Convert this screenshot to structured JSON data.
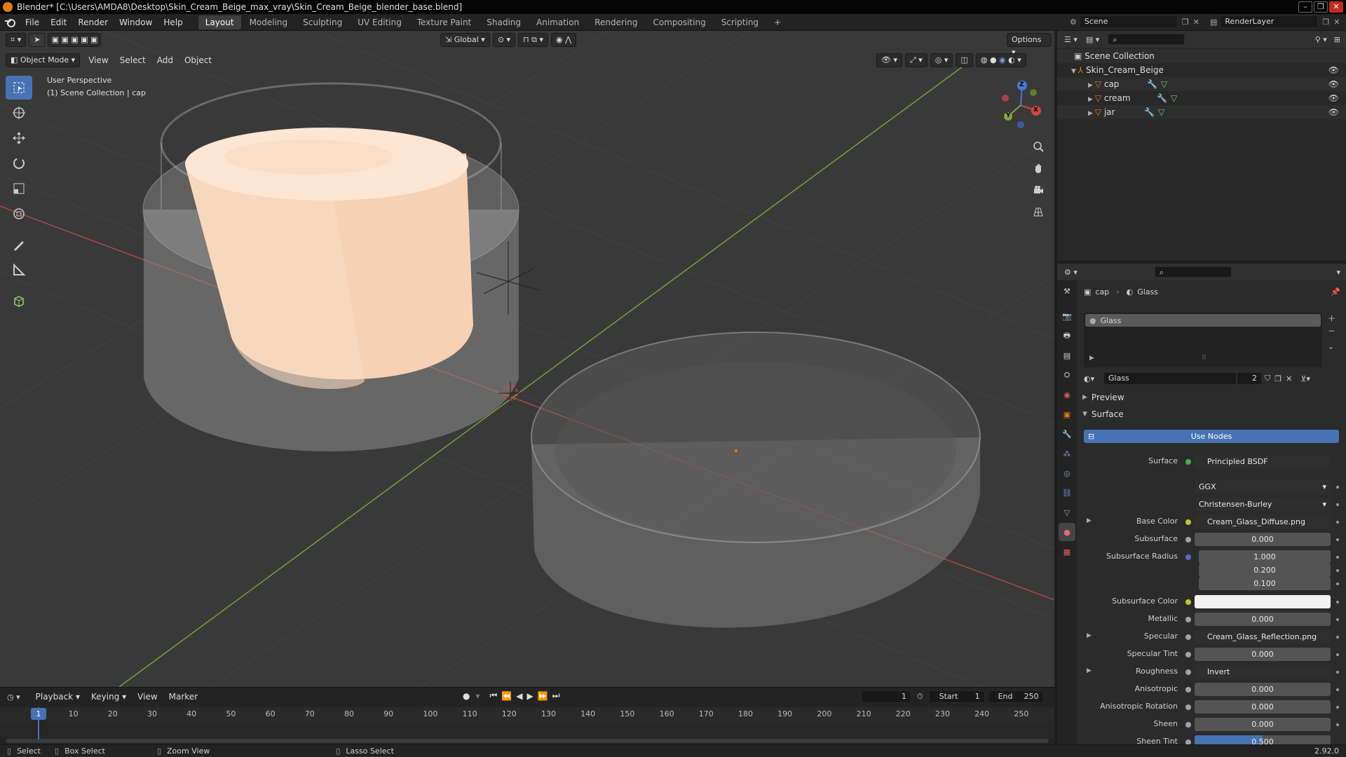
{
  "window": {
    "title": "Blender* [C:\\Users\\AMDA8\\Desktop\\Skin_Cream_Beige_max_vray\\Skin_Cream_Beige_blender_base.blend]"
  },
  "menu": {
    "items": [
      "File",
      "Edit",
      "Render",
      "Window",
      "Help"
    ],
    "workspaces": [
      "Layout",
      "Modeling",
      "Sculpting",
      "UV Editing",
      "Texture Paint",
      "Shading",
      "Animation",
      "Rendering",
      "Compositing",
      "Scripting"
    ],
    "active_workspace": "Layout",
    "add_tab": "+",
    "scene": "Scene",
    "render_layer": "RenderLayer"
  },
  "viewport": {
    "transform_orientation": "Global",
    "options_label": "Options",
    "mode": "Object Mode",
    "menus": [
      "View",
      "Select",
      "Add",
      "Object"
    ],
    "perspective_label": "User Perspective",
    "collection_label": "(1) Scene Collection | cap",
    "gizmo_axes": {
      "x": "X",
      "y": "Y",
      "z": "Z"
    }
  },
  "outliner": {
    "root": "Scene Collection",
    "collection": "Skin_Cream_Beige",
    "objects": [
      {
        "name": "cap"
      },
      {
        "name": "cream"
      },
      {
        "name": "jar"
      }
    ]
  },
  "properties": {
    "breadcrumb_object": "cap",
    "breadcrumb_material": "Glass",
    "material_slots": [
      "Glass"
    ],
    "material_name": "Glass",
    "user_count": "2",
    "panels": {
      "preview": "Preview",
      "surface": "Surface"
    },
    "use_nodes_label": "Use Nodes",
    "surface_label": "Surface",
    "surface_shader": "Principled BSDF",
    "distribution": "GGX",
    "subsurface_method": "Christensen-Burley",
    "rows": [
      {
        "label": "Base Color",
        "value": "Cream_Glass_Diffuse.png"
      },
      {
        "label": "Subsurface",
        "value": "0.000"
      },
      {
        "label": "Subsurface Radius",
        "value": "1.000"
      },
      {
        "label": "",
        "value": "0.200"
      },
      {
        "label": "",
        "value": "0.100"
      },
      {
        "label": "Subsurface Color",
        "value": ""
      },
      {
        "label": "Metallic",
        "value": "0.000"
      },
      {
        "label": "Specular",
        "value": "Cream_Glass_Reflection.png"
      },
      {
        "label": "Specular Tint",
        "value": "0.000"
      },
      {
        "label": "Roughness",
        "value": "Invert"
      },
      {
        "label": "Anisotropic",
        "value": "0.000"
      },
      {
        "label": "Anisotropic Rotation",
        "value": "0.000"
      },
      {
        "label": "Sheen",
        "value": "0.000"
      },
      {
        "label": "Sheen Tint",
        "value": "0.500"
      }
    ]
  },
  "timeline": {
    "menus": [
      "Playback",
      "Keying",
      "View",
      "Marker"
    ],
    "current_frame": "1",
    "start_label": "Start",
    "start": "1",
    "end_label": "End",
    "end": "250",
    "ticks": [
      "1",
      "10",
      "20",
      "30",
      "40",
      "50",
      "60",
      "70",
      "80",
      "90",
      "100",
      "110",
      "120",
      "130",
      "140",
      "150",
      "160",
      "170",
      "180",
      "190",
      "200",
      "210",
      "220",
      "230",
      "240",
      "250"
    ]
  },
  "statusbar": {
    "select": "Select",
    "box_select": "Box Select",
    "zoom_view": "Zoom View",
    "lasso_select": "Lasso Select",
    "version": "2.92.0"
  },
  "colors": {
    "accent": "#4772b3",
    "cream": "#f6d1b4",
    "x_axis": "#c94747",
    "y_axis": "#7fa53a",
    "orange": "#e87d0d"
  }
}
